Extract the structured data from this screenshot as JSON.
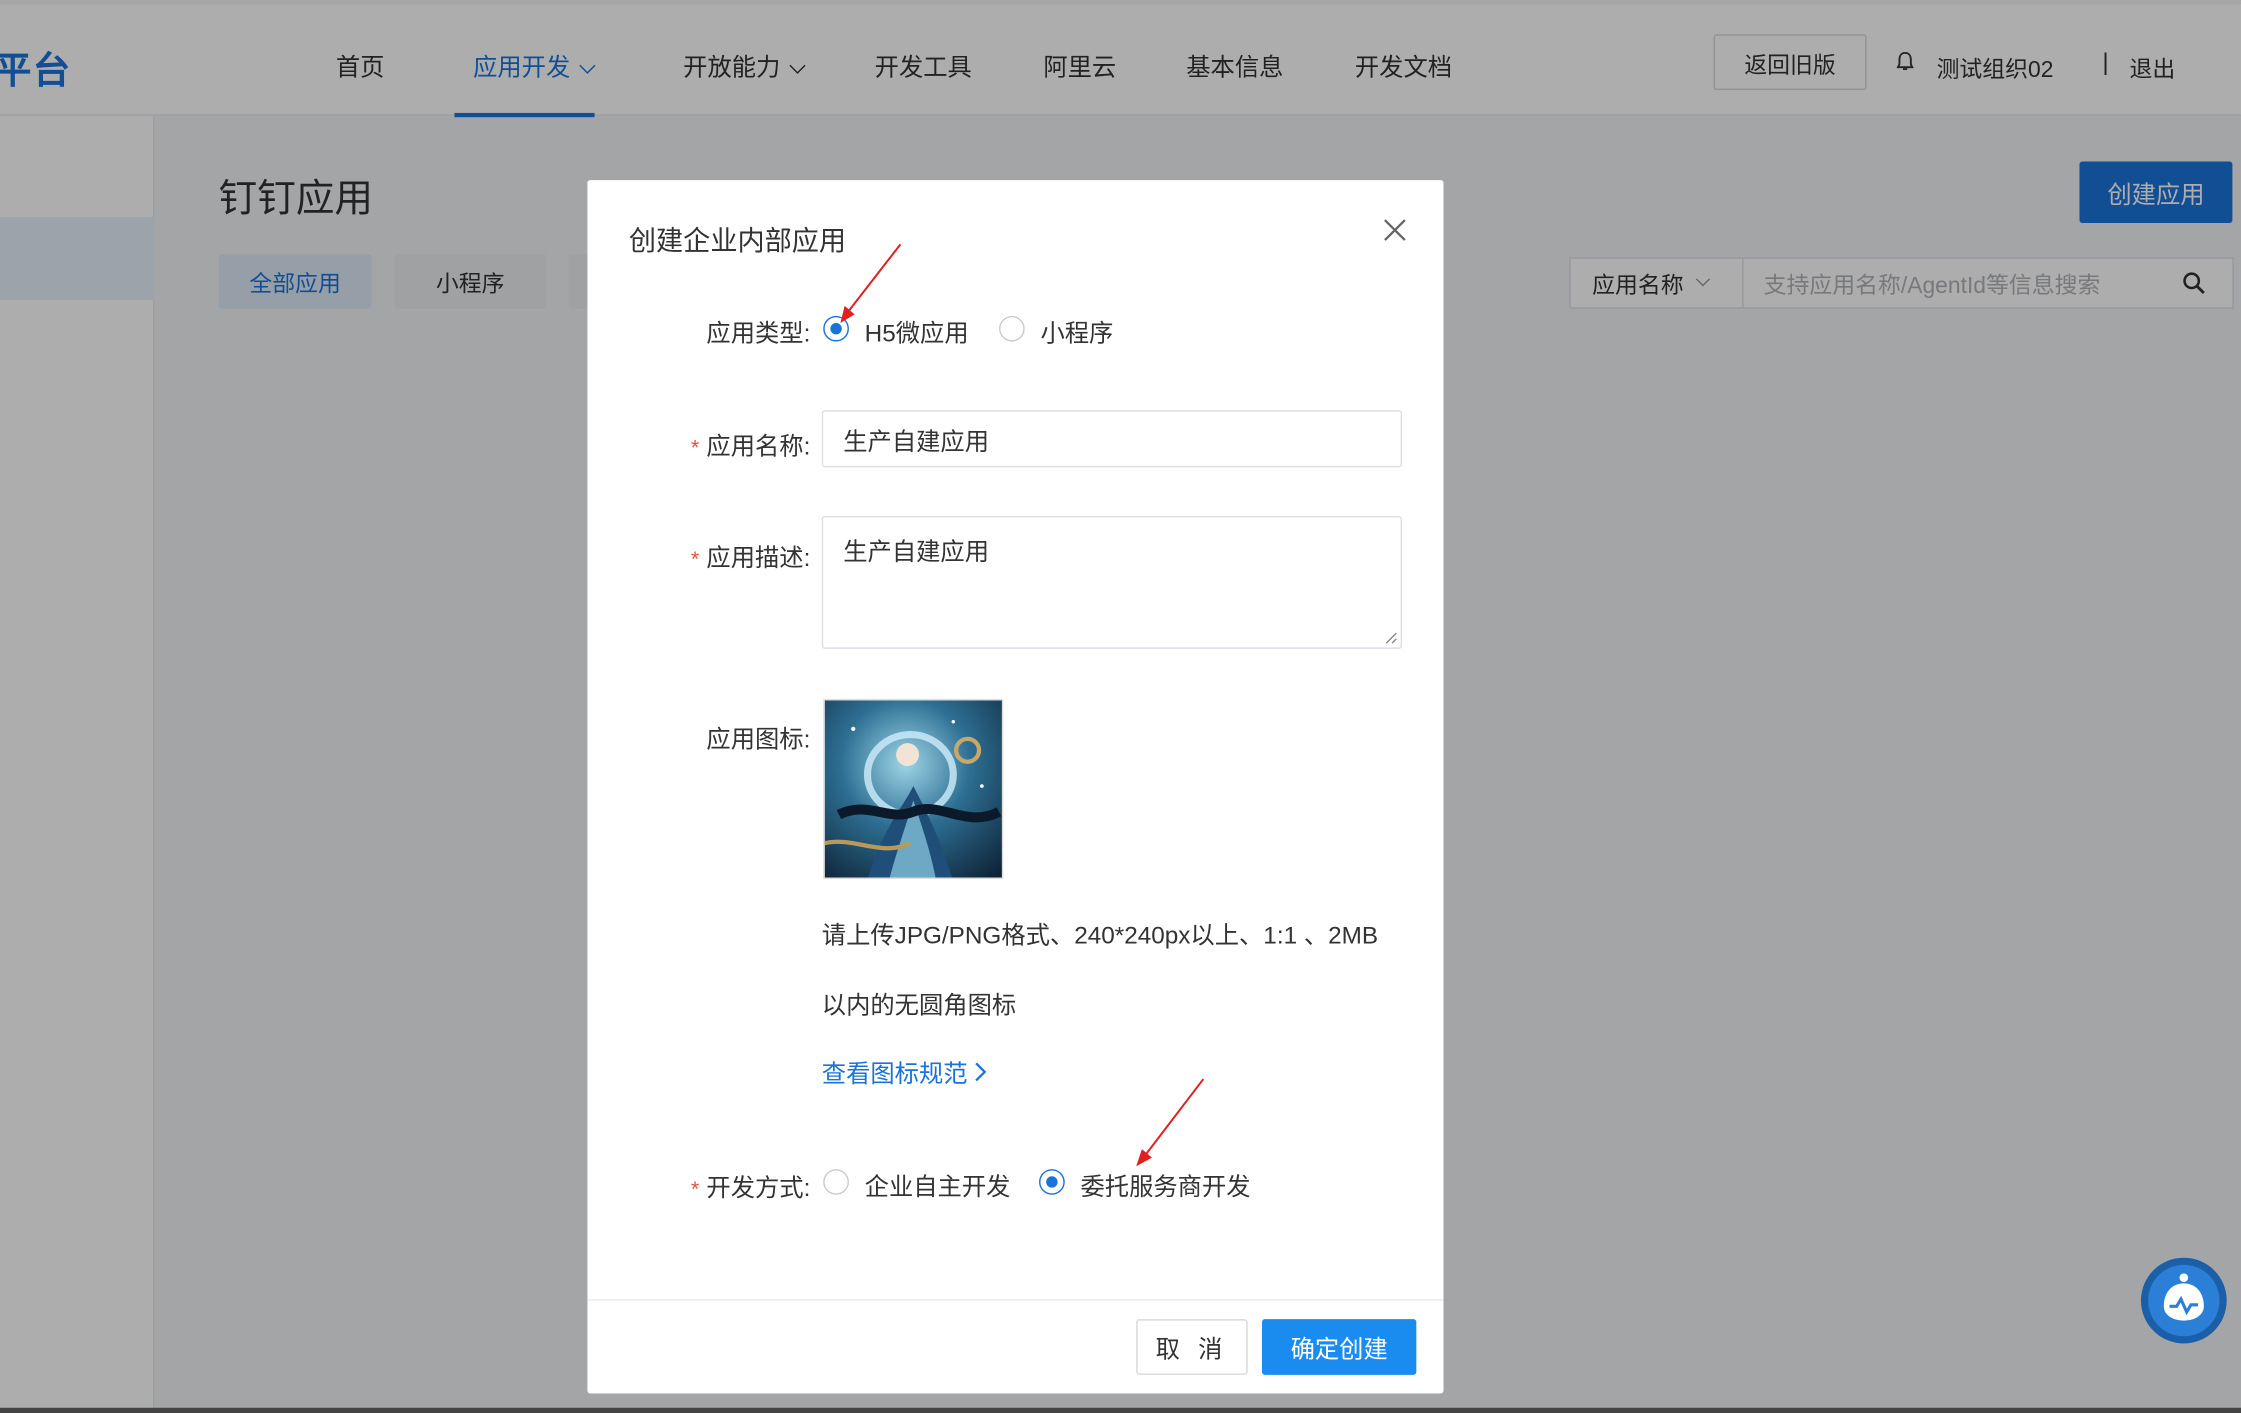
{
  "header": {
    "brand": "平台",
    "nav": [
      {
        "label": "首页"
      },
      {
        "label": "应用开发",
        "active": true
      },
      {
        "label": "开放能力"
      },
      {
        "label": "开发工具"
      },
      {
        "label": "阿里云"
      },
      {
        "label": "基本信息"
      },
      {
        "label": "开发文档"
      }
    ],
    "old_version_label": "返回旧版",
    "org_name": "测试组织02",
    "separator": "|",
    "logout_label": "退出"
  },
  "page": {
    "title": "钉钉应用",
    "tabs": [
      {
        "label": "全部应用",
        "active": true
      },
      {
        "label": "小程序"
      }
    ],
    "create_label": "创建应用",
    "search": {
      "type_label": "应用名称",
      "placeholder": "支持应用名称/AgentId等信息搜索"
    }
  },
  "modal": {
    "title": "创建企业内部应用",
    "app_type": {
      "label": "应用类型:",
      "options": [
        {
          "label": "H5微应用",
          "selected": true
        },
        {
          "label": "小程序",
          "selected": false
        }
      ]
    },
    "app_name": {
      "label": "应用名称:",
      "required": true,
      "value": "生产自建应用"
    },
    "app_desc": {
      "label": "应用描述:",
      "required": true,
      "value": "生产自建应用"
    },
    "app_icon": {
      "label": "应用图标:",
      "hint_line1": "请上传JPG/PNG格式、240*240px以上、1:1 、2MB",
      "hint_line2": "以内的无圆角图标",
      "link_label": "查看图标规范"
    },
    "dev_mode": {
      "label": "开发方式:",
      "required": true,
      "options": [
        {
          "label": "企业自主开发",
          "selected": false
        },
        {
          "label": "委托服务商开发",
          "selected": true
        }
      ]
    },
    "cancel_label": "取 消",
    "confirm_label": "确定创建",
    "required_mark": "*"
  },
  "colors": {
    "primary": "#1a73d9",
    "confirm": "#1a8cf0",
    "required": "#e74c3c",
    "annotation_arrow": "#e02020"
  },
  "icons": [
    "bell-icon",
    "search-icon",
    "close-icon",
    "chevron-down-icon",
    "chevron-right-icon",
    "assistant-icon"
  ]
}
